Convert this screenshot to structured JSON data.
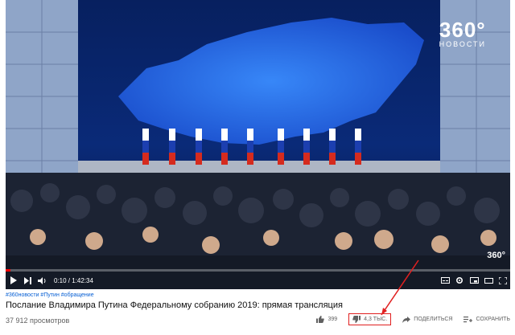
{
  "player": {
    "logo_number": "360°",
    "logo_subtitle": "НОВОСТИ",
    "corner_badge": "360°",
    "time_current": "0:10",
    "time_total": "1:42:34",
    "progress_fraction": 0.0016
  },
  "video": {
    "hashtags": "#360новости #Путин #обращение",
    "title": "Послание Владимира Путина Федеральному собранию 2019: прямая трансляция",
    "views": "37 912 просмотров"
  },
  "actions": {
    "likes": "399",
    "dislikes": "4,3 ТЫС.",
    "share": "ПОДЕЛИТЬСЯ",
    "save": "СОХРАНИТЬ"
  },
  "colors": {
    "accent": "#ff0000",
    "highlight": "#e02020",
    "link": "#065fd4"
  }
}
